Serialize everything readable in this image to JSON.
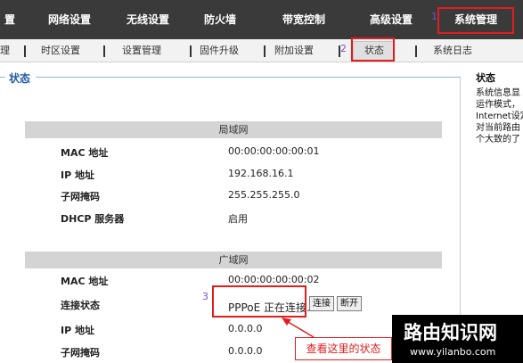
{
  "topnav": {
    "items": [
      "置",
      "网络设置",
      "无线设置",
      "防火墙",
      "带宽控制",
      "高级设置",
      "系统管理"
    ]
  },
  "subnav": {
    "items": [
      "理",
      "时区设置",
      "设置管理",
      "固件升级",
      "附加设置",
      "状态",
      "系统日志"
    ]
  },
  "annotations": {
    "num1": "1",
    "num2": "2",
    "num3": "3",
    "callout": "查看这里的状态"
  },
  "page": {
    "title": "状态"
  },
  "lan": {
    "heading": "局域网",
    "rows": [
      {
        "label": "MAC 地址",
        "value": "00:00:00:00:00:01"
      },
      {
        "label": "IP 地址",
        "value": "192.168.16.1"
      },
      {
        "label": "子网掩码",
        "value": "255.255.255.0"
      },
      {
        "label": "DHCP 服务器",
        "value": "启用"
      }
    ]
  },
  "wan": {
    "heading": "广域网",
    "mac_label": "MAC 地址",
    "mac_value": "00:00:00:00:00:02",
    "status_label": "连接状态",
    "status_value": "PPPoE 正在连接...",
    "connect_button": "连接",
    "disconnect_button": "断开",
    "ip_label": "IP 地址",
    "ip_value": "0.0.0.0",
    "mask_label": "子网掩码",
    "mask_value": "0.0.0.0"
  },
  "side": {
    "title": "状态",
    "lines": [
      "系统信息显",
      "运作模式，",
      "Internet设定",
      "对当前路由",
      "个大致的了"
    ]
  },
  "watermark": {
    "title": "路由知识网",
    "url": "www.yilanbo.com"
  },
  "colors": {
    "annotation_red": "#e21d1d",
    "annotation_number": "#7b4fc4",
    "title_blue": "#205ba5",
    "topnav_bg": "#3a3a3a"
  }
}
